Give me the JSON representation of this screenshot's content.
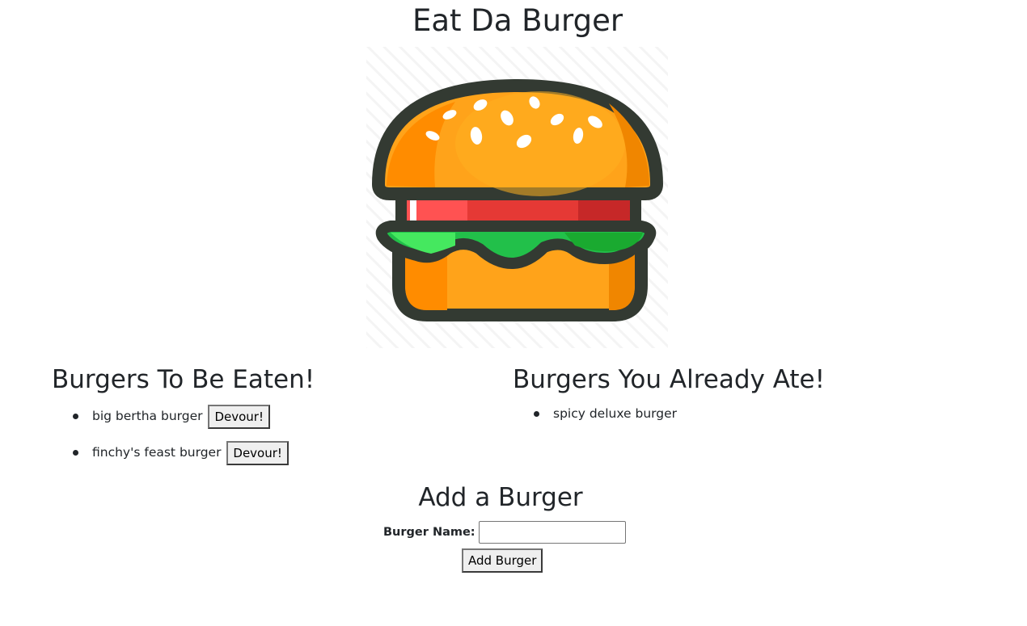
{
  "header": {
    "title": "Eat Da Burger",
    "logo": "burger-logo"
  },
  "uneaten": {
    "title": "Burgers To Be Eaten!",
    "items": [
      {
        "name": "big bertha burger",
        "button": "Devour!"
      },
      {
        "name": "finchy's feast burger",
        "button": "Devour!"
      }
    ]
  },
  "eaten": {
    "title": "Burgers You Already Ate!",
    "items": [
      {
        "name": "spicy deluxe burger"
      }
    ]
  },
  "add_form": {
    "title": "Add a Burger",
    "label": "Burger Name:",
    "input_value": "",
    "input_placeholder": "",
    "submit_label": "Add Burger"
  },
  "colors": {
    "text": "#212529",
    "bun_light": "#ffa31a",
    "bun_dark": "#ff8c00",
    "outline": "#333a32",
    "tomato": "#e53935",
    "lettuce": "#22c04a"
  }
}
